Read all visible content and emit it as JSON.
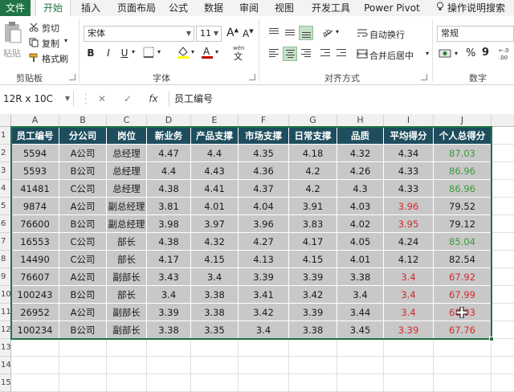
{
  "tabs": [
    "文件",
    "开始",
    "插入",
    "页面布局",
    "公式",
    "数据",
    "审阅",
    "视图",
    "开发工具",
    "Power Pivot",
    "操作说明搜索"
  ],
  "clipboard": {
    "paste": "粘贴",
    "cut": "剪切",
    "copy": "复制",
    "format_painter": "格式刷",
    "label": "剪贴板"
  },
  "font": {
    "name": "宋体",
    "size": "11",
    "bold": "B",
    "italic": "I",
    "underline": "U",
    "grow": "A",
    "shrink": "A",
    "label": "字体",
    "color_accent": "#c00000",
    "fill_accent": "#ffff00"
  },
  "alignment": {
    "wrap": "自动换行",
    "merge": "合并后居中",
    "label": "对齐方式"
  },
  "number": {
    "format": "常规",
    "percent": "%",
    "comma": "9",
    "label": "数字"
  },
  "formula_bar": {
    "name_box": "12R x 10C",
    "cancel": "✕",
    "enter": "✓",
    "fx": "fx",
    "content": "员工编号"
  },
  "columns": [
    "A",
    "B",
    "C",
    "D",
    "E",
    "F",
    "G",
    "H",
    "I",
    "J"
  ],
  "rows": [
    "1",
    "2",
    "3",
    "4",
    "5",
    "6",
    "7",
    "8",
    "9",
    "10",
    "11",
    "12",
    "13",
    "14",
    "15"
  ],
  "table": {
    "headers": [
      "员工编号",
      "分公司",
      "岗位",
      "新业务",
      "产品支撑",
      "市场支撑",
      "日常支撑",
      "品质",
      "平均得分",
      "个人总得分"
    ],
    "rows": [
      [
        "5594",
        "A公司",
        "总经理",
        "4.47",
        "4.4",
        "4.35",
        "4.18",
        "4.32",
        "4.34",
        "87.03"
      ],
      [
        "5593",
        "B公司",
        "总经理",
        "4.4",
        "4.43",
        "4.36",
        "4.2",
        "4.26",
        "4.33",
        "86.96"
      ],
      [
        "41481",
        "C公司",
        "总经理",
        "4.38",
        "4.41",
        "4.37",
        "4.2",
        "4.3",
        "4.33",
        "86.96"
      ],
      [
        "9874",
        "A公司",
        "副总经理",
        "3.81",
        "4.01",
        "4.04",
        "3.91",
        "4.03",
        "3.96",
        "79.52"
      ],
      [
        "76600",
        "B公司",
        "副总经理",
        "3.98",
        "3.97",
        "3.96",
        "3.83",
        "4.02",
        "3.95",
        "79.12"
      ],
      [
        "16553",
        "C公司",
        "部长",
        "4.38",
        "4.32",
        "4.27",
        "4.17",
        "4.05",
        "4.24",
        "85.04"
      ],
      [
        "14490",
        "C公司",
        "部长",
        "4.17",
        "4.15",
        "4.13",
        "4.15",
        "4.01",
        "4.12",
        "82.54"
      ],
      [
        "76607",
        "A公司",
        "副部长",
        "3.43",
        "3.4",
        "3.39",
        "3.39",
        "3.38",
        "3.4",
        "67.92"
      ],
      [
        "100243",
        "B公司",
        "部长",
        "3.4",
        "3.38",
        "3.41",
        "3.42",
        "3.4",
        "3.4",
        "67.99"
      ],
      [
        "26952",
        "A公司",
        "副部长",
        "3.39",
        "3.38",
        "3.42",
        "3.39",
        "3.44",
        "3.4",
        "68.03"
      ],
      [
        "100234",
        "B公司",
        "副部长",
        "3.38",
        "3.35",
        "3.4",
        "3.38",
        "3.45",
        "3.39",
        "67.76"
      ]
    ],
    "colors": {
      "8": [
        "",
        "",
        "",
        "red",
        "red",
        "",
        "",
        "red",
        "red",
        "red",
        "red"
      ],
      "9": [
        "green",
        "green",
        "green",
        "",
        "",
        "green",
        "",
        "red",
        "red",
        "red",
        "red"
      ]
    }
  },
  "colors": {
    "brand": "#217346",
    "header_fill": "#1e4e5e",
    "body_fill": "#c8c8c8",
    "red": "#d12a2a",
    "green": "#3a9a3a"
  }
}
